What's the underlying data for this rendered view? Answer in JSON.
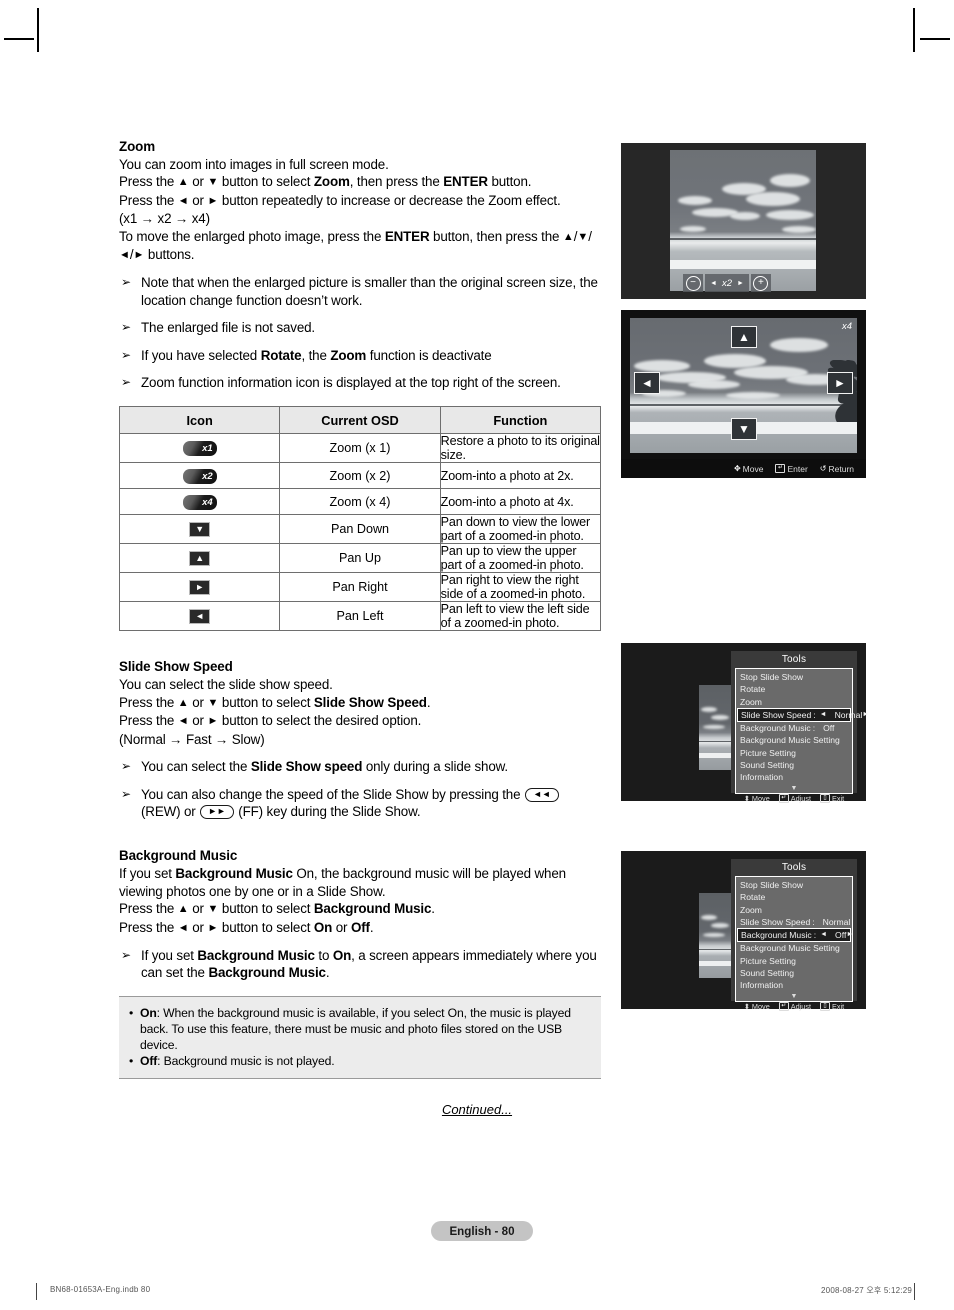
{
  "doc": {
    "page_badge": "English - 80",
    "continued": "Continued...",
    "footer_left": "BN68-01653A-Eng.indb   80",
    "footer_right": "2008-08-27   오후 5:12:29"
  },
  "zoom_section": {
    "heading": "Zoom",
    "lines": [
      "You can zoom into images in full screen mode.",
      "Press the ▲ or ▼ button to select Zoom, then press the ENTER button.",
      "Press the ◄ or ► button repeatedly to increase or decrease the Zoom effect.",
      "(x1 → x2 → x4)",
      "To move the enlarged photo image, press the ENTER button, then press the ▲/▼/◄/► buttons."
    ],
    "line1": "You can zoom into images in full screen mode.",
    "l2_a": "Press the ",
    "l2_b": " or ",
    "l2_c": " button to select ",
    "l2_zoom": "Zoom",
    "l2_d": ", then press the ",
    "l2_enter": "ENTER",
    "l2_e": " button.",
    "l3_a": "Press the ",
    "l3_b": " or ",
    "l3_c": " button repeatedly to increase or decrease the Zoom effect.",
    "l4": "(x1 → x2 → x4)",
    "l5_a": "To move the enlarged photo image, press the ",
    "l5_enter": "ENTER",
    "l5_b": " button, then press the ",
    "l5_c": " buttons.",
    "notes": [
      "Note that when the enlarged picture is smaller than the original screen size, the location change function doesn’t work.",
      "The enlarged file is not saved.",
      "If you have selected Rotate, the Zoom function is deactivate",
      "Zoom function information icon is displayed at the top right of the screen."
    ],
    "note1": "Note that when the enlarged picture is smaller than the original screen size, the location change function doesn’t work.",
    "note2": "The enlarged file is not saved.",
    "note3_a": "If you have selected ",
    "note3_rotate": "Rotate",
    "note3_b": ", the ",
    "note3_zoom": "Zoom",
    "note3_c": " function is deactivate",
    "note4": "Zoom function information icon is displayed at the top right of the screen."
  },
  "icon_table": {
    "headers": [
      "Icon",
      "Current OSD",
      "Function"
    ],
    "rows": [
      {
        "icon": "x1",
        "icon_type": "pill",
        "osd": "Zoom (x 1)",
        "fn": "Restore a photo to its original size."
      },
      {
        "icon": "x2",
        "icon_type": "pill",
        "osd": "Zoom (x 2)",
        "fn": "Zoom-into a photo at 2x."
      },
      {
        "icon": "x4",
        "icon_type": "pill",
        "osd": "Zoom (x 4)",
        "fn": "Zoom-into a photo at 4x."
      },
      {
        "icon": "▼",
        "icon_type": "square",
        "osd": "Pan Down",
        "fn": "Pan down to view the lower part of a zoomed-in photo."
      },
      {
        "icon": "▲",
        "icon_type": "square",
        "osd": "Pan Up",
        "fn": "Pan up to view the upper part of a zoomed-in photo."
      },
      {
        "icon": "►",
        "icon_type": "square",
        "osd": "Pan Right",
        "fn": "Pan right to view the right side of a zoomed-in photo."
      },
      {
        "icon": "◄",
        "icon_type": "square",
        "osd": "Pan Left",
        "fn": "Pan left to view the left side of a zoomed-in photo."
      }
    ]
  },
  "slideshow_section": {
    "heading": "Slide Show Speed",
    "l1": "You can select the slide show speed.",
    "l2_a": "Press the ",
    "l2_b": " or ",
    "l2_c": " button to select ",
    "l2_bold": "Slide Show Speed",
    "l2_d": ".",
    "l3_a": "Press the ",
    "l3_b": " or ",
    "l3_c": " button to select the desired option.",
    "l4": "(Normal → Fast → Slow)",
    "note1_a": "You can select the ",
    "note1_bold": "Slide Show speed",
    "note1_b": " only during a slide show.",
    "note2_a": "You can also change the speed of the Slide Show by pressing the ",
    "note2_rew_label": "(REW)",
    "note2_or": " or ",
    "note2_ff_label": "(FF)",
    "note2_b": " key during the Slide Show.",
    "rew_glyph": "◄◄",
    "ff_glyph": "►►"
  },
  "bgmusic_section": {
    "heading": "Background Music",
    "l1_a": "If you set ",
    "l1_bold": "Background Music",
    "l1_b": " On, the background music will be played when viewing photos one by one or in a Slide Show.",
    "l2_a": "Press the ",
    "l2_b": " or ",
    "l2_c": " button to select ",
    "l2_bold": "Background Music",
    "l2_d": ".",
    "l3_a": "Press the ",
    "l3_b": " or ",
    "l3_c": " button to select ",
    "l3_on": "On",
    "l3_or": " or ",
    "l3_off": "Off",
    "l3_d": ".",
    "note_a": "If you set ",
    "note_bold1": "Background Music",
    "note_b": " to ",
    "note_on": "On",
    "note_c": ", a screen appears immediately where you can set the ",
    "note_bold2": "Background Music",
    "note_d": ".",
    "box": {
      "on_label": "On",
      "on_text": ": When the background music is available, if you select On, the music is played back. To use this feature, there must be music and photo files stored on the USB device.",
      "off_label": "Off",
      "off_text": ": Background music is not played."
    }
  },
  "fig_zoombar": {
    "minus": "⊖",
    "left_tri": "◄",
    "level": "x2",
    "right_tri": "►",
    "plus": "⊕"
  },
  "fig_pan": {
    "up": "▲",
    "down": "▼",
    "left": "◄",
    "right": "►",
    "level_tag": "x4",
    "osd_move": "Move",
    "osd_enter": "Enter",
    "osd_return": "Return"
  },
  "tools_menu_1": {
    "title": "Tools",
    "items": [
      {
        "label": "Stop Slide Show",
        "selected": false
      },
      {
        "label": "Rotate",
        "selected": false
      },
      {
        "label": "Zoom",
        "selected": false
      },
      {
        "label": "Slide Show Speed",
        "value": "Normal",
        "selected": true,
        "arrows": true
      },
      {
        "label": "Background Music",
        "value": "Off",
        "selected": false,
        "arrows": false
      },
      {
        "label": "Background Music Setting",
        "selected": false
      },
      {
        "label": "Picture Setting",
        "selected": false
      },
      {
        "label": "Sound Setting",
        "selected": false
      },
      {
        "label": "Information",
        "selected": false
      }
    ],
    "more": "▼",
    "footer": {
      "move": "Move",
      "adjust": "Adjust",
      "exit": "Exit"
    }
  },
  "tools_menu_2": {
    "title": "Tools",
    "items": [
      {
        "label": "Stop Slide Show",
        "selected": false
      },
      {
        "label": "Rotate",
        "selected": false
      },
      {
        "label": "Zoom",
        "selected": false
      },
      {
        "label": "Slide Show Speed",
        "value": "Normal",
        "selected": false,
        "arrows": false
      },
      {
        "label": "Background Music",
        "value": "Off",
        "selected": true,
        "arrows": true
      },
      {
        "label": "Background Music Setting",
        "selected": false
      },
      {
        "label": "Picture Setting",
        "selected": false
      },
      {
        "label": "Sound Setting",
        "selected": false
      },
      {
        "label": "Information",
        "selected": false
      }
    ],
    "more": "▼",
    "footer": {
      "move": "Move",
      "adjust": "Adjust",
      "exit": "Exit"
    }
  }
}
